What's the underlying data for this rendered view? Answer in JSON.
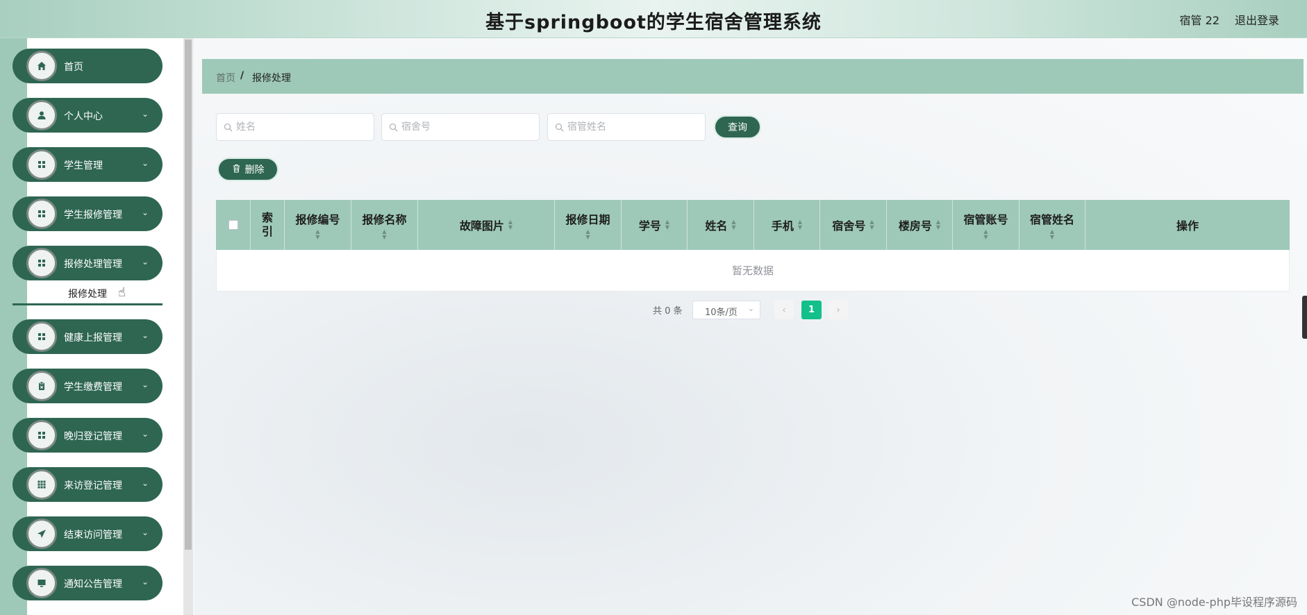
{
  "header": {
    "title": "基于springboot的学生宿舍管理系统",
    "user": "宿管 22",
    "logout": "退出登录"
  },
  "sidebar": {
    "items": [
      {
        "label": "首页",
        "icon": "home-icon",
        "chevron": false
      },
      {
        "label": "个人中心",
        "icon": "user-icon",
        "chevron": true
      },
      {
        "label": "学生管理",
        "icon": "grid-icon",
        "chevron": true
      },
      {
        "label": "学生报修管理",
        "icon": "grid-icon",
        "chevron": true
      },
      {
        "label": "报修处理管理",
        "icon": "grid-icon",
        "chevron": true
      },
      {
        "label": "健康上报管理",
        "icon": "grid-icon",
        "chevron": true
      },
      {
        "label": "学生缴费管理",
        "icon": "clipboard-icon",
        "chevron": true
      },
      {
        "label": "晚归登记管理",
        "icon": "grid-icon",
        "chevron": true
      },
      {
        "label": "来访登记管理",
        "icon": "apps-icon",
        "chevron": true
      },
      {
        "label": "结束访问管理",
        "icon": "send-icon",
        "chevron": true
      },
      {
        "label": "通知公告管理",
        "icon": "monitor-icon",
        "chevron": true
      }
    ],
    "sub_item": "报修处理"
  },
  "breadcrumb": {
    "home": "首页",
    "separator": "/",
    "current": "报修处理"
  },
  "search": {
    "name_placeholder": "姓名",
    "dorm_placeholder": "宿舍号",
    "manager_placeholder": "宿管姓名",
    "query_button": "查询"
  },
  "actions": {
    "delete_button": "删除"
  },
  "table": {
    "columns": {
      "index": "索引",
      "repair_no": "报修编号",
      "repair_name": "报修名称",
      "fault_image": "故障图片",
      "repair_date": "报修日期",
      "student_no": "学号",
      "name": "姓名",
      "phone": "手机",
      "dorm_no": "宿舍号",
      "building_no": "楼房号",
      "manager_account": "宿管账号",
      "manager_name": "宿管姓名",
      "operation": "操作"
    },
    "empty_text": "暂无数据"
  },
  "pagination": {
    "total": "共 0 条",
    "page_size": "10条/页",
    "current_page": "1",
    "prev": "‹",
    "next": "›"
  },
  "watermark": "CSDN @node-php毕设程序源码",
  "colors": {
    "primary": "#2e6652",
    "accent_light": "#9ec9b8",
    "page_active": "#13c08a"
  }
}
